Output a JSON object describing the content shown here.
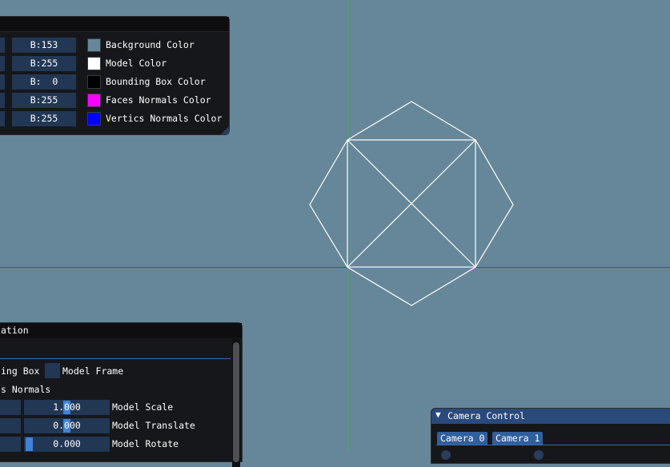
{
  "viewport": {
    "background_color": "#668799",
    "axis_x_color": "#cc1f1f",
    "axis_y_color": "#1fcc1f",
    "model_color": "#ffffff"
  },
  "color_panel": {
    "rows": [
      {
        "b_value": "B:153",
        "label": "Background Color",
        "swatch": "#668799"
      },
      {
        "b_value": "B:255",
        "label": "Model Color",
        "swatch": "#ffffff"
      },
      {
        "b_value": "B:  0",
        "label": "Bounding Box Color",
        "swatch": "#000000"
      },
      {
        "b_value": "B:255",
        "label": "Faces Normals Color",
        "swatch": "#ff00ff"
      },
      {
        "b_value": "B:255",
        "label": "Vertics Normals Color",
        "swatch": "#0000ff"
      }
    ]
  },
  "transform_panel": {
    "title": "ation",
    "bounding_box_label": "ing Box",
    "model_frame_label": "Model Frame",
    "normals_label": "s Normals",
    "model_scale": {
      "value": "1.000",
      "label": "Model Scale"
    },
    "model_translate": {
      "value": "0.000",
      "label": "Model Translate"
    },
    "model_rotate": {
      "value": "0.000",
      "label": "Model Rotate"
    }
  },
  "camera_panel": {
    "title": "Camera Control",
    "collapse_icon": "triangle-down-icon",
    "tabs": [
      "Camera 0",
      "Camera 1"
    ]
  }
}
